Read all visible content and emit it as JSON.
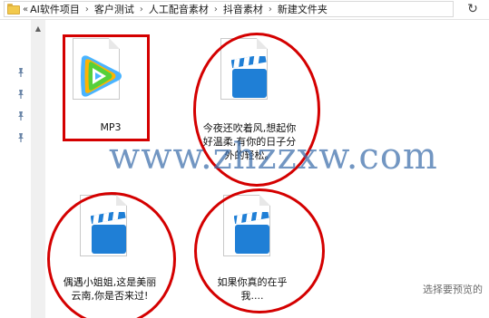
{
  "address_bar": {
    "breadcrumbs": [
      "AI软件项目",
      "客户测试",
      "人工配音素材",
      "抖音素材",
      "新建文件夹"
    ],
    "lead_chevron": "«"
  },
  "files": [
    {
      "label": "MP3",
      "icon": "tencent-video-icon"
    },
    {
      "label": "今夜还吹着风,想起你好温柔,有你的日子分外的轻松。",
      "icon": "clapperboard-video-icon"
    },
    {
      "label": "偶遇小姐姐,这是美丽云南,你是否来过!",
      "icon": "clapperboard-video-icon"
    },
    {
      "label": "如果你真的在乎我....",
      "icon": "clapperboard-video-icon"
    }
  ],
  "watermark": "www.zhzzxw.com",
  "preview_hint": "选择要预览的",
  "colors": {
    "annotation_red": "#d40000",
    "clapper_blue": "#1f7fd6",
    "watermark": "#3c6eaa"
  }
}
